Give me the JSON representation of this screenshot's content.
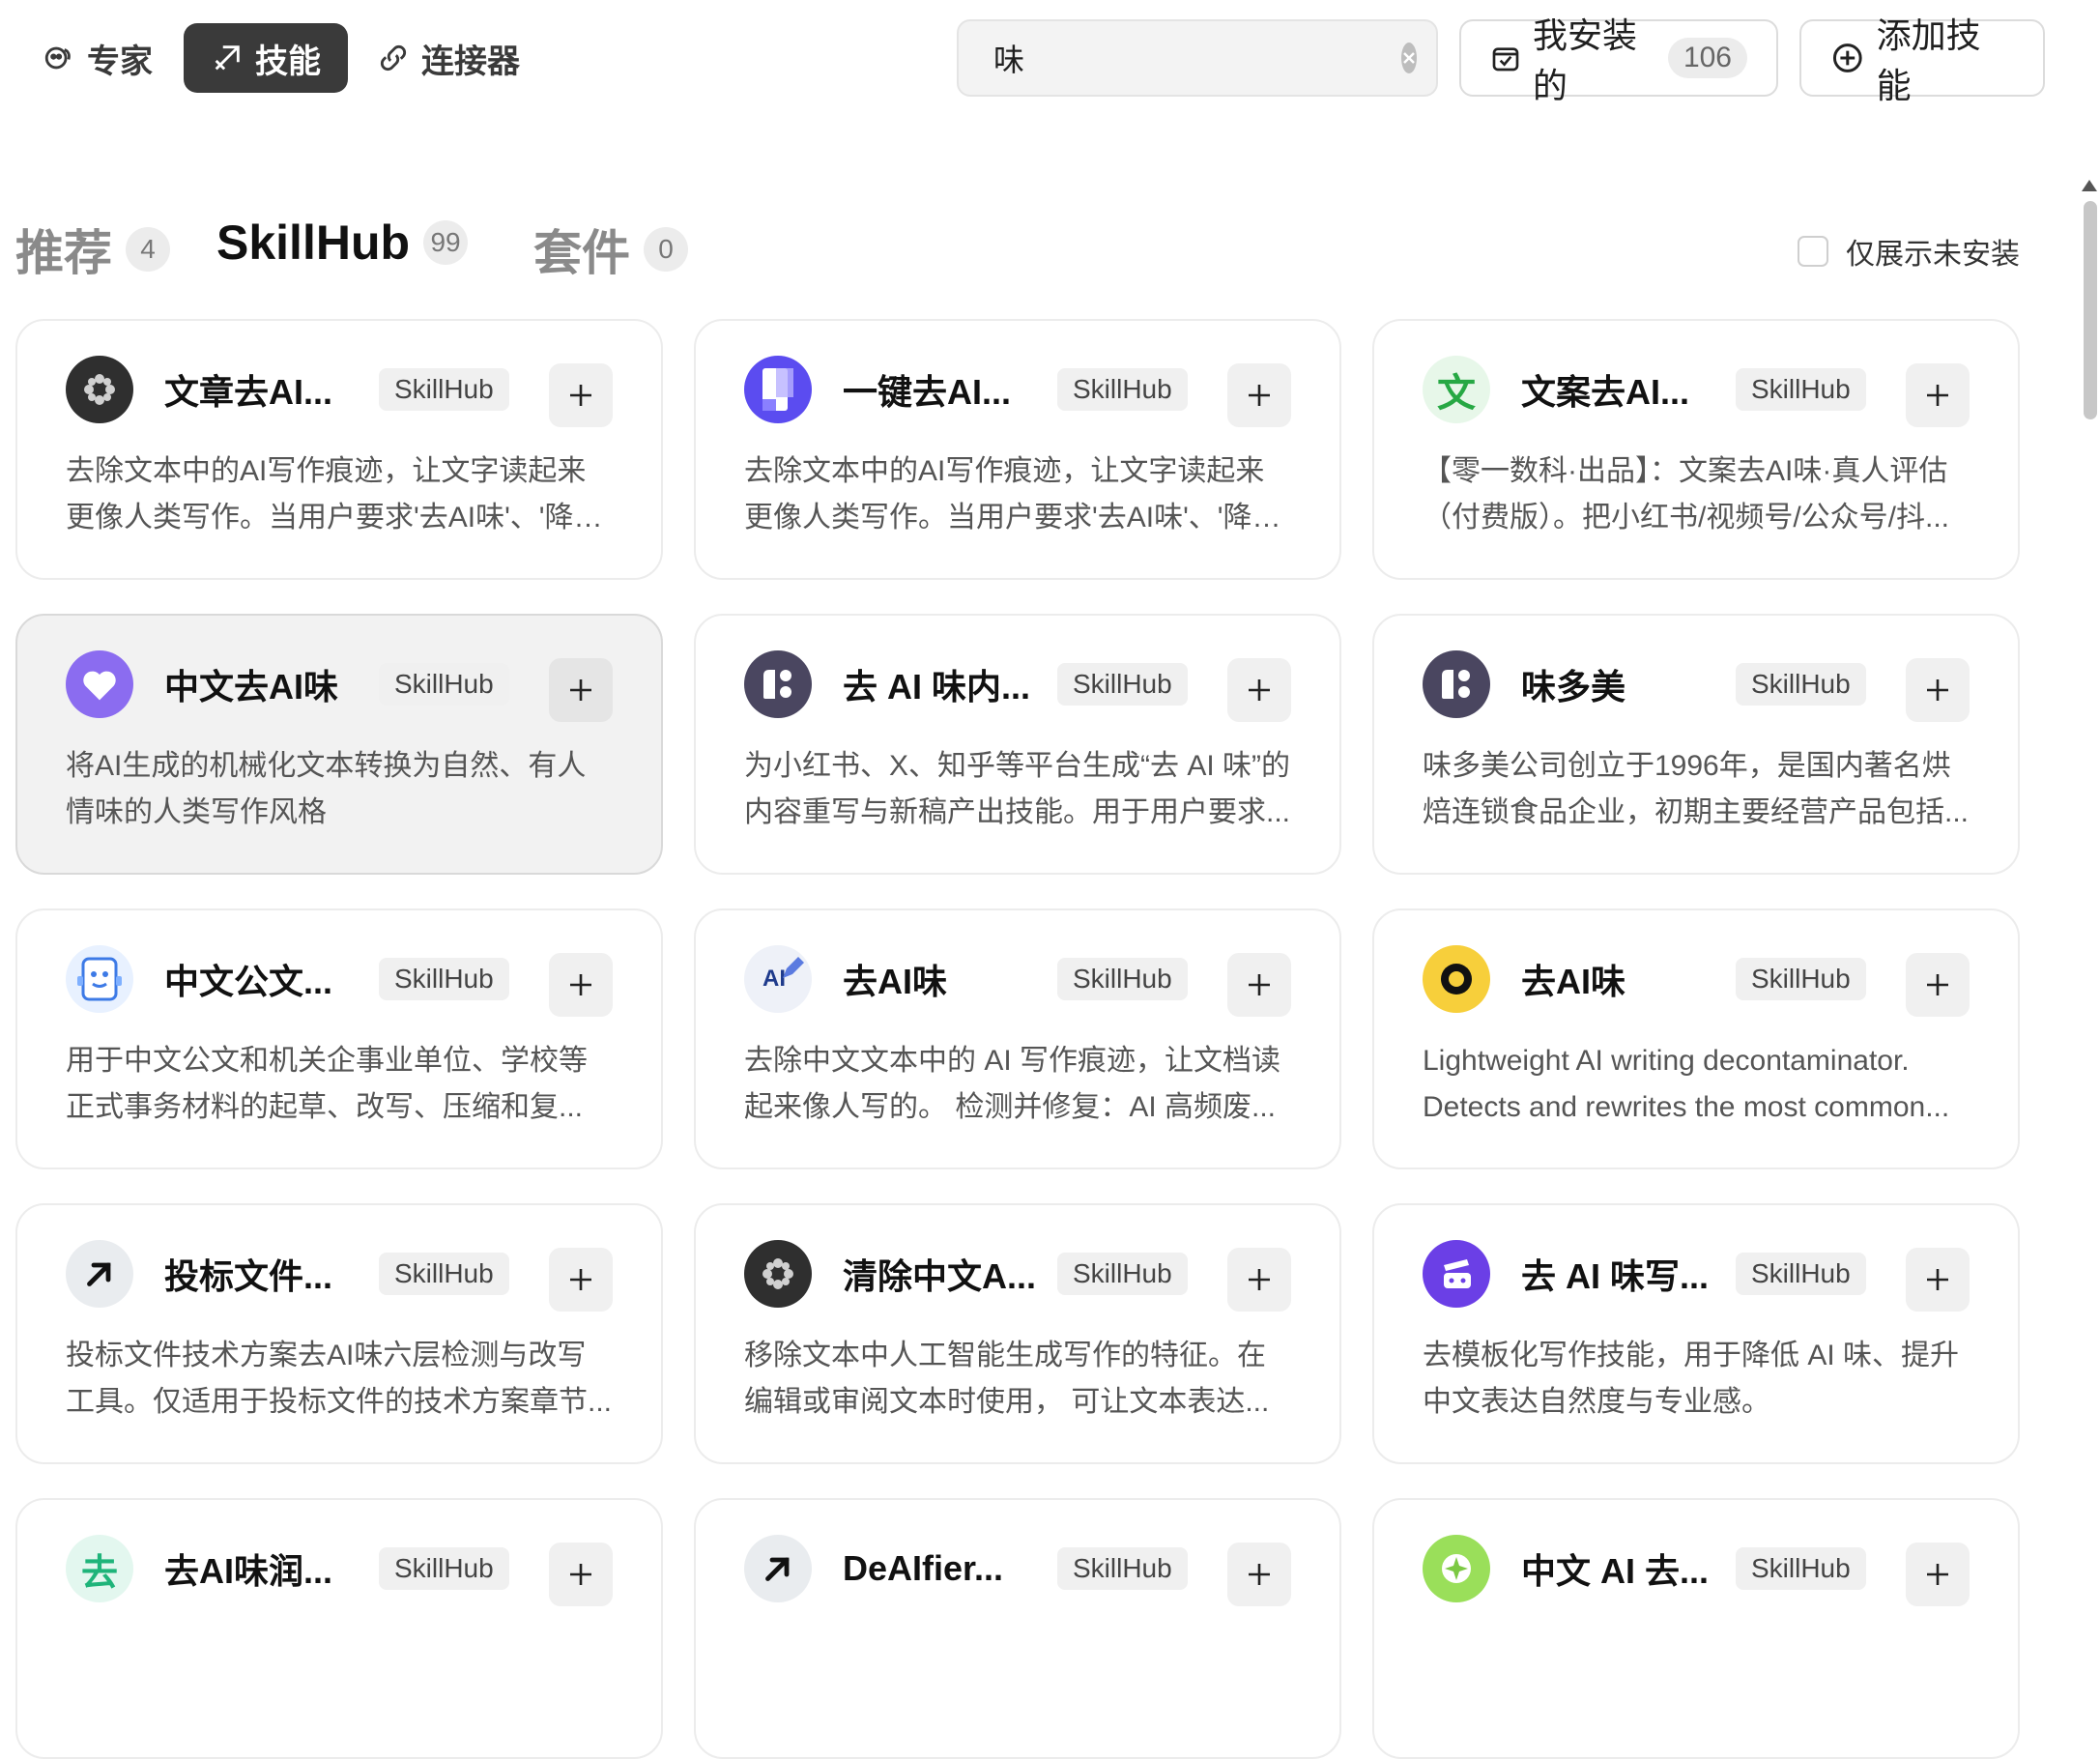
{
  "nav": {
    "tabs": [
      {
        "label": "专家",
        "icon": "expert-icon",
        "active": false
      },
      {
        "label": "技能",
        "icon": "skill-icon",
        "active": true
      },
      {
        "label": "连接器",
        "icon": "link-icon",
        "active": false
      }
    ]
  },
  "search": {
    "value": "味",
    "placeholder": ""
  },
  "toolbar": {
    "installed_label": "我安装的",
    "installed_count": "106",
    "add_label": "添加技能"
  },
  "categories": [
    {
      "label": "推荐",
      "count": "4",
      "active": false
    },
    {
      "label": "SkillHub",
      "count": "99",
      "active": true
    },
    {
      "label": "套件",
      "count": "0",
      "active": false
    }
  ],
  "filter": {
    "label": "仅展示未安装",
    "checked": false
  },
  "cards": [
    {
      "title": "文章去AI...",
      "badge": "SkillHub",
      "icon": "flower-dots-icon",
      "desc": "去除文本中的AI写作痕迹，让文字读起来更像人类写作。当用户要求'去AI味'、'降AI..."
    },
    {
      "title": "一键去AI...",
      "badge": "SkillHub",
      "icon": "document-gradient-icon",
      "desc": "去除文本中的AI写作痕迹，让文字读起来更像人类写作。当用户要求'去AI味'、'降AI..."
    },
    {
      "title": "文案去AI...",
      "badge": "SkillHub",
      "icon": "wen-character-icon",
      "desc": "【零一数科·出品】：文案去AI味·真人评估（付费版）。把小红书/视频号/公众号/抖..."
    },
    {
      "title": "中文去AI味",
      "badge": "SkillHub",
      "icon": "heart-icon",
      "desc": "将AI生成的机械化文本转换为自然、有人情味的人类写作风格"
    },
    {
      "title": "去 AI 味内...",
      "badge": "SkillHub",
      "icon": "shape-blocks-icon",
      "desc": "为小红书、X、知乎等平台生成“去 AI 味”的内容重写与新稿产出技能。用于用户要求..."
    },
    {
      "title": "味多美",
      "badge": "SkillHub",
      "icon": "shape-blocks-icon",
      "desc": "味多美公司创立于1996年，是国内著名烘焙连锁食品企业，初期主要经营产品包括..."
    },
    {
      "title": "中文公文...",
      "badge": "SkillHub",
      "icon": "robot-paper-icon",
      "desc": "用于中文公文和机关企事业单位、学校等正式事务材料的起草、改写、压缩和复..."
    },
    {
      "title": "去AI味",
      "badge": "SkillHub",
      "icon": "ai-pen-icon",
      "desc": "去除中文文本中的 AI 写作痕迹，让文档读起来像人写的。 检测并修复：AI 高频废..."
    },
    {
      "title": "去AI味",
      "badge": "SkillHub",
      "icon": "ring-icon",
      "desc": "Lightweight AI writing decontaminator. Detects and rewrites the most common..."
    },
    {
      "title": "投标文件...",
      "badge": "SkillHub",
      "icon": "arrow-up-right-icon",
      "desc": "投标文件技术方案去AI味六层检测与改写工具。仅适用于投标文件的技术方案章节..."
    },
    {
      "title": "清除中文A...",
      "badge": "SkillHub",
      "icon": "flower-dots-icon",
      "desc": "移除文本中人工智能生成写作的特征。在编辑或审阅文本时使用， 可让文本表达..."
    },
    {
      "title": "去 AI 味写...",
      "badge": "SkillHub",
      "icon": "face-card-icon",
      "desc": "去模板化写作技能，用于降低 AI 味、提升中文表达自然度与专业感。"
    },
    {
      "title": "去AI味润...",
      "badge": "SkillHub",
      "icon": "qu-character-icon",
      "desc": ""
    },
    {
      "title": "DeAIfier...",
      "badge": "SkillHub",
      "icon": "arrow-up-right-icon",
      "desc": ""
    },
    {
      "title": "中文 AI 去...",
      "badge": "SkillHub",
      "icon": "star-green-icon",
      "desc": ""
    }
  ],
  "icon_chars": {
    "wen": "文",
    "qu": "去",
    "ai": "AI"
  },
  "colors": {
    "primary_dark": "#3a3a3a",
    "purple": "#6b5cf5",
    "violet": "#8b6cf0",
    "green_bg": "#e7f7e9"
  }
}
